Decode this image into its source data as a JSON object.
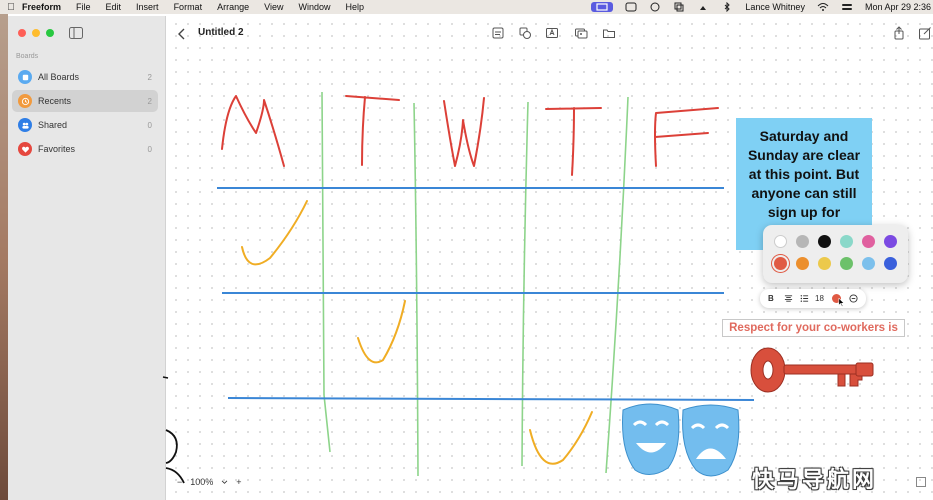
{
  "menubar": {
    "items": [
      "Freeform",
      "File",
      "Edit",
      "Insert",
      "Format",
      "Arrange",
      "View",
      "Window",
      "Help"
    ],
    "user": "Lance Whitney",
    "datetime": "Mon Apr 29  2:36"
  },
  "sidebar": {
    "section": "Boards",
    "items": [
      {
        "label": "All Boards",
        "count": "2",
        "icon": "boards-icon",
        "color": "#5aaaf0"
      },
      {
        "label": "Recents",
        "count": "2",
        "icon": "clock-icon",
        "color": "#f19a3e"
      },
      {
        "label": "Shared",
        "count": "0",
        "icon": "people-icon",
        "color": "#2f7ee6"
      },
      {
        "label": "Favorites",
        "count": "0",
        "icon": "heart-icon",
        "color": "#e5483f"
      }
    ]
  },
  "toolbar": {
    "title": "Untitled 2",
    "buttons": [
      "note-icon",
      "shapes-icon",
      "text-box-icon",
      "media-icon",
      "folder-icon",
      "share-icon",
      "compose-icon"
    ]
  },
  "board": {
    "day_letters": [
      "M",
      "T",
      "W",
      "T",
      "F"
    ],
    "sticky_lines": [
      "Saturday and",
      "Sunday are clear",
      "at this point. But",
      "anyone can still",
      "sign up for"
    ],
    "sticky_color": "#7fd0f4",
    "text_box": "Respect for your co-workers is",
    "text_color": "#e06a5e"
  },
  "color_picker": {
    "swatches": [
      "#ffffff",
      "#b6b6b6",
      "#111111",
      "#8ad8c9",
      "#e0609f",
      "#7b4ae2",
      "#e05a44",
      "#ec8f2d",
      "#ecc94b",
      "#6cc16a",
      "#7cc0ec",
      "#3a60dc"
    ]
  },
  "format_bar": {
    "bold": "B",
    "font_size": "18"
  },
  "zoom": {
    "minus": "−",
    "value": "100%",
    "plus": "+"
  },
  "watermark": "快马导航网"
}
